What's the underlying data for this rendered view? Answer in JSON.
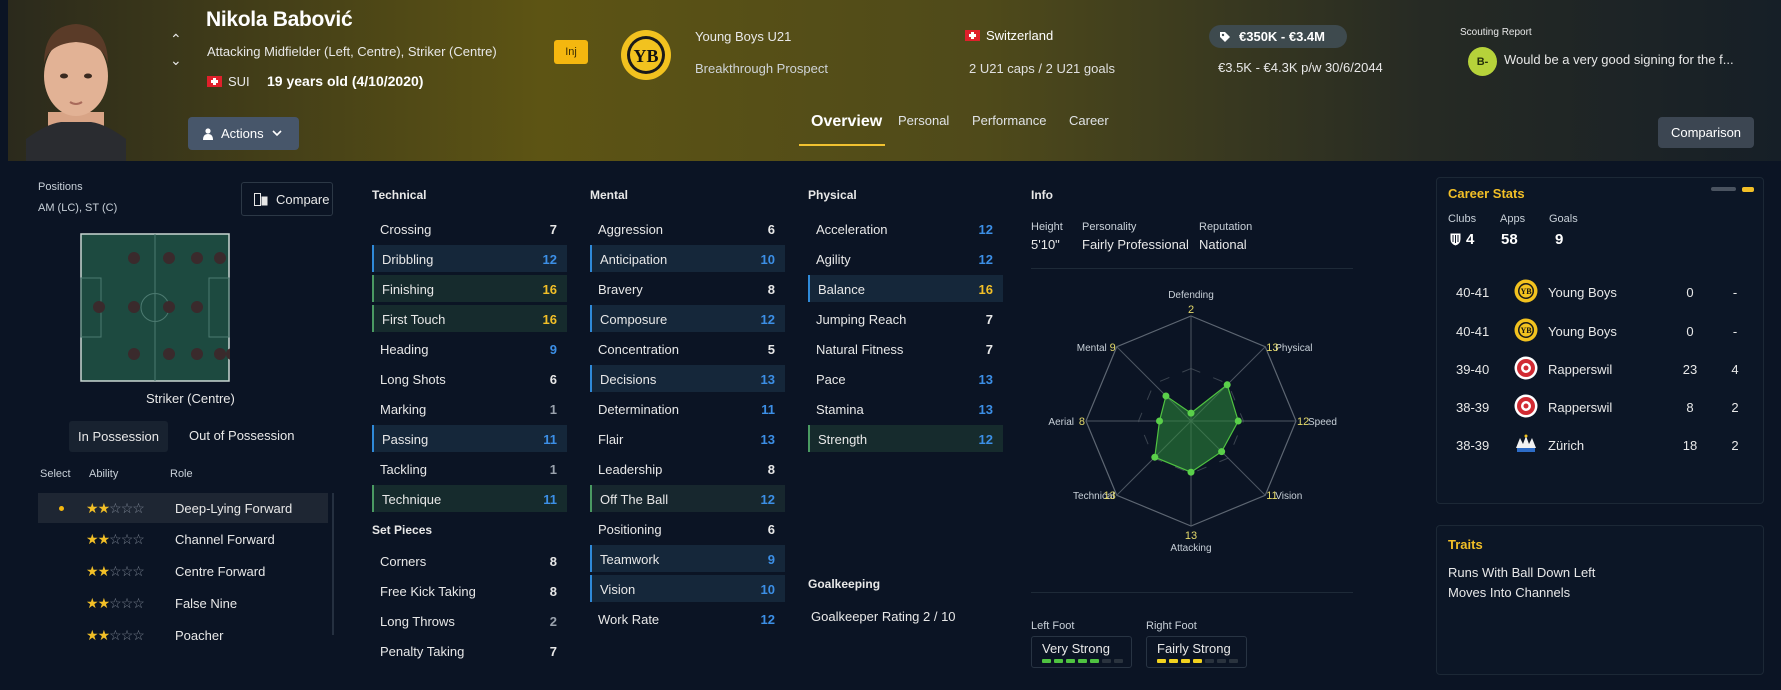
{
  "player": {
    "name": "Nikola Babović",
    "positions": "Attacking Midfielder (Left, Centre), Striker (Centre)",
    "nationality_code": "SUI",
    "age": "19 years old (4/10/2020)",
    "injury_badge": "Inj"
  },
  "header": {
    "actions_label": "Actions",
    "club_name": "Young Boys U21",
    "club_status": "Breakthrough Prospect",
    "nation": "Switzerland",
    "caps": "2 U21 caps / 2 U21 goals",
    "value": "€350K - €3.4M",
    "wage": "€3.5K - €4.3K p/w 30/6/2044",
    "scouting_title": "Scouting Report",
    "scouting_grade": "B-",
    "scouting_text": "Would be a very good signing for the f...",
    "tabs": [
      "Overview",
      "Personal",
      "Performance",
      "Career"
    ],
    "comparison_label": "Comparison",
    "accent_color": "#f1c230"
  },
  "positions_panel": {
    "title": "Positions",
    "list": "AM (LC), ST (C)",
    "compare_label": "Compare",
    "selected_position": "Striker (Centre)",
    "tab_in": "In Possession",
    "tab_out": "Out of Possession",
    "col_select": "Select",
    "col_ability": "Ability",
    "col_role": "Role",
    "roles": [
      {
        "name": "Deep-Lying Forward",
        "stars": 2,
        "selected": true
      },
      {
        "name": "Channel Forward",
        "stars": 2,
        "selected": false
      },
      {
        "name": "Centre Forward",
        "stars": 2,
        "selected": false
      },
      {
        "name": "False Nine",
        "stars": 2,
        "selected": false
      },
      {
        "name": "Poacher",
        "stars": 2,
        "selected": false
      }
    ]
  },
  "attributes": {
    "technical_title": "Technical",
    "technical": [
      {
        "name": "Crossing",
        "value": 7
      },
      {
        "name": "Dribbling",
        "value": 12
      },
      {
        "name": "Finishing",
        "value": 16
      },
      {
        "name": "First Touch",
        "value": 16
      },
      {
        "name": "Heading",
        "value": 9
      },
      {
        "name": "Long Shots",
        "value": 6
      },
      {
        "name": "Marking",
        "value": 1
      },
      {
        "name": "Passing",
        "value": 11
      },
      {
        "name": "Tackling",
        "value": 1
      },
      {
        "name": "Technique",
        "value": 11
      }
    ],
    "set_pieces_title": "Set Pieces",
    "set_pieces": [
      {
        "name": "Corners",
        "value": 8
      },
      {
        "name": "Free Kick Taking",
        "value": 8
      },
      {
        "name": "Long Throws",
        "value": 2
      },
      {
        "name": "Penalty Taking",
        "value": 7
      }
    ],
    "mental_title": "Mental",
    "mental": [
      {
        "name": "Aggression",
        "value": 6
      },
      {
        "name": "Anticipation",
        "value": 10
      },
      {
        "name": "Bravery",
        "value": 8
      },
      {
        "name": "Composure",
        "value": 12
      },
      {
        "name": "Concentration",
        "value": 5
      },
      {
        "name": "Decisions",
        "value": 13
      },
      {
        "name": "Determination",
        "value": 11
      },
      {
        "name": "Flair",
        "value": 13
      },
      {
        "name": "Leadership",
        "value": 8
      },
      {
        "name": "Off The Ball",
        "value": 12
      },
      {
        "name": "Positioning",
        "value": 6
      },
      {
        "name": "Teamwork",
        "value": 9
      },
      {
        "name": "Vision",
        "value": 10
      },
      {
        "name": "Work Rate",
        "value": 12
      }
    ],
    "physical_title": "Physical",
    "physical": [
      {
        "name": "Acceleration",
        "value": 12
      },
      {
        "name": "Agility",
        "value": 12
      },
      {
        "name": "Balance",
        "value": 16
      },
      {
        "name": "Jumping Reach",
        "value": 7
      },
      {
        "name": "Natural Fitness",
        "value": 7
      },
      {
        "name": "Pace",
        "value": 13
      },
      {
        "name": "Stamina",
        "value": 13
      },
      {
        "name": "Strength",
        "value": 12
      }
    ],
    "goalkeeping_title": "Goalkeeping",
    "goalkeeper_rating": "Goalkeeper Rating  2 / 10"
  },
  "info": {
    "title": "Info",
    "height_label": "Height",
    "height": "5'10\"",
    "personality_label": "Personality",
    "personality": "Fairly Professional",
    "reputation_label": "Reputation",
    "reputation": "National",
    "left_foot_label": "Left Foot",
    "left_foot": "Very Strong",
    "left_foot_level": 5,
    "right_foot_label": "Right Foot",
    "right_foot": "Fairly Strong",
    "right_foot_level": 4
  },
  "radar": {
    "axes": [
      {
        "label": "Defending",
        "value": 2
      },
      {
        "label": "Physical",
        "value": 13
      },
      {
        "label": "Speed",
        "value": 12
      },
      {
        "label": "Vision",
        "value": 11
      },
      {
        "label": "Attacking",
        "value": 13
      },
      {
        "label": "Technical",
        "value": 13
      },
      {
        "label": "Aerial",
        "value": 8
      },
      {
        "label": "Mental",
        "value": 9
      }
    ],
    "max": 20
  },
  "career": {
    "title": "Career Stats",
    "clubs_label": "Clubs",
    "clubs": "4",
    "apps_label": "Apps",
    "apps": "58",
    "goals_label": "Goals",
    "goals": "9",
    "rows": [
      {
        "season": "40-41",
        "club": "Young Boys",
        "apps": "0",
        "goals": "-",
        "logo": "yb"
      },
      {
        "season": "40-41",
        "club": "Young Boys",
        "apps": "0",
        "goals": "-",
        "logo": "yb"
      },
      {
        "season": "39-40",
        "club": "Rapperswil",
        "apps": "23",
        "goals": "4",
        "logo": "rap"
      },
      {
        "season": "38-39",
        "club": "Rapperswil",
        "apps": "8",
        "goals": "2",
        "logo": "rap"
      },
      {
        "season": "38-39",
        "club": "Zürich",
        "apps": "18",
        "goals": "2",
        "logo": "zur"
      }
    ]
  },
  "traits": {
    "title": "Traits",
    "items": [
      "Runs With Ball Down Left",
      "Moves Into Channels"
    ]
  }
}
